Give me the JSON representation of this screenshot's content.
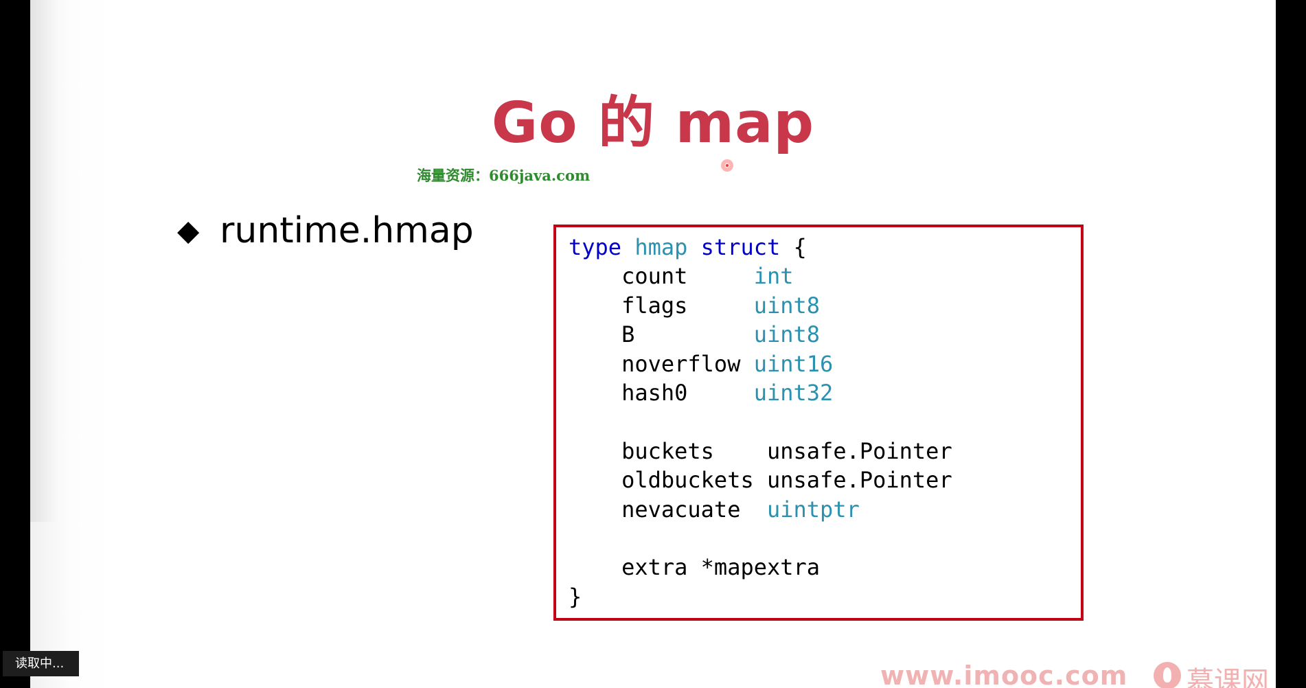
{
  "slide": {
    "title": "Go 的 map",
    "watermark": "海量资源：666java.com",
    "bullet_symbol": "◆",
    "bullet_text": "runtime.hmap"
  },
  "code": {
    "lines": [
      [
        {
          "t": "type",
          "c": "kw"
        },
        {
          "t": " "
        },
        {
          "t": "hmap",
          "c": "ty"
        },
        {
          "t": " "
        },
        {
          "t": "struct",
          "c": "kw"
        },
        {
          "t": " {"
        }
      ],
      [
        {
          "t": "    count     "
        },
        {
          "t": "int",
          "c": "ty"
        }
      ],
      [
        {
          "t": "    flags     "
        },
        {
          "t": "uint8",
          "c": "ty"
        }
      ],
      [
        {
          "t": "    B         "
        },
        {
          "t": "uint8",
          "c": "ty"
        }
      ],
      [
        {
          "t": "    noverflow "
        },
        {
          "t": "uint16",
          "c": "ty"
        }
      ],
      [
        {
          "t": "    hash0     "
        },
        {
          "t": "uint32",
          "c": "ty"
        }
      ],
      [
        {
          "t": ""
        }
      ],
      [
        {
          "t": "    buckets    unsafe.Pointer"
        }
      ],
      [
        {
          "t": "    oldbuckets unsafe.Pointer"
        }
      ],
      [
        {
          "t": "    nevacuate  "
        },
        {
          "t": "uintptr",
          "c": "ty"
        }
      ],
      [
        {
          "t": ""
        }
      ],
      [
        {
          "t": "    extra *mapextra"
        }
      ],
      [
        {
          "t": "}"
        }
      ]
    ]
  },
  "player": {
    "loading_text": "读取中..."
  },
  "branding": {
    "url": "www.imooc.com",
    "name": "慕课网"
  },
  "colors": {
    "title": "#c8384a",
    "code_border": "#c00015",
    "keyword": "#0000c8",
    "type": "#2b91af",
    "watermark": "#2e8b2e"
  }
}
